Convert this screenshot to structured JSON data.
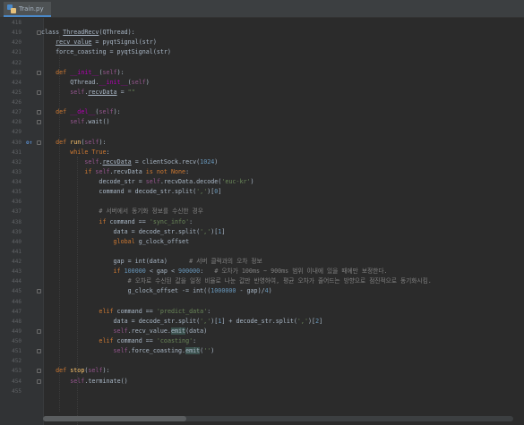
{
  "tab": {
    "label": "Train.py"
  },
  "lines": [
    {
      "num": "418",
      "code": ""
    },
    {
      "num": "419",
      "code": "class <span class=\"ul\">ThreadRecv</span>(QThread):"
    },
    {
      "num": "420",
      "code": "    <span class=\"ul\">recv_value</span> = pyqtSignal(str)"
    },
    {
      "num": "421",
      "code": "    force_coasting = pyqtSignal(str)"
    },
    {
      "num": "422",
      "code": ""
    },
    {
      "num": "423",
      "code": "    <span class=\"kw\">def</span> <span class=\"dn\">__init__</span>(<span class=\"sf\">self</span>):"
    },
    {
      "num": "424",
      "code": "        QThread.<span class=\"dn\">__init__</span>(<span class=\"sf\">self</span>)"
    },
    {
      "num": "425",
      "code": "        <span class=\"sf\">self</span>.<span class=\"ul\">recvData</span> = <span class=\"st\">\"\"</span>"
    },
    {
      "num": "426",
      "code": ""
    },
    {
      "num": "427",
      "code": "    <span class=\"kw\">def</span> <span class=\"dn\">__del__</span>(<span class=\"sf\">self</span>):"
    },
    {
      "num": "428",
      "code": "        <span class=\"sf\">self</span>.wait()"
    },
    {
      "num": "429",
      "code": ""
    },
    {
      "num": "430",
      "code": "    <span class=\"kw\">def</span> <span class=\"fn\">run</span>(<span class=\"sf\">self</span>):",
      "marker": "o↑"
    },
    {
      "num": "431",
      "code": "        <span class=\"kw\">while</span> <span class=\"kw\">True</span>:"
    },
    {
      "num": "432",
      "code": "            <span class=\"sf\">self</span>.<span class=\"ul\">recvData</span> = clientSock.recv(<span class=\"nm\">1024</span>)"
    },
    {
      "num": "433",
      "code": "            <span class=\"kw\">if</span> <span class=\"sf\">self</span>.recvData <span class=\"kw\">is not None</span>:"
    },
    {
      "num": "434",
      "code": "                decode_str = <span class=\"sf\">self</span>.recvData.decode(<span class=\"st\">'euc-kr'</span>)"
    },
    {
      "num": "435",
      "code": "                command = decode_str.split(<span class=\"st\">','</span>)[<span class=\"nm\">0</span>]"
    },
    {
      "num": "436",
      "code": ""
    },
    {
      "num": "437",
      "code": "                <span class=\"cm\"># 서버에서 동기화 정보를 수신한 경우</span>"
    },
    {
      "num": "438",
      "code": "                <span class=\"kw\">if</span> command == <span class=\"st\">'sync_info'</span>:"
    },
    {
      "num": "439",
      "code": "                    data = decode_str.split(<span class=\"st\">','</span>)[<span class=\"nm\">1</span>]"
    },
    {
      "num": "440",
      "code": "                    <span class=\"kw\">global</span> g_clock_offset"
    },
    {
      "num": "441",
      "code": ""
    },
    {
      "num": "442",
      "code": "                    gap = int(data)      <span class=\"cm\"># 서버 클럭과의 오차 정보</span>"
    },
    {
      "num": "443",
      "code": "                    <span class=\"kw\">if</span> <span class=\"nm\">100000</span> &lt; gap &lt; <span class=\"nm\">900000</span>:   <span class=\"cm\"># 오차가 100ms ~ 900ms 범위 이내에 있을 때에만 보정한다.</span>"
    },
    {
      "num": "444",
      "code": "                        <span class=\"cm\"># 오차로 수신된 값을 일정 비율로 나눈 값만 반영하여, 평균 오차가 줄어드는 방향으로 점진적으로 동기화시킴.</span>"
    },
    {
      "num": "445",
      "code": "                        g_clock_offset -= int((<span class=\"nm\">1000000</span> - gap)/<span class=\"nm\">4</span>)"
    },
    {
      "num": "446",
      "code": ""
    },
    {
      "num": "447",
      "code": "                <span class=\"kw\">elif</span> command == <span class=\"st\">'predict_data'</span>:"
    },
    {
      "num": "448",
      "code": "                    data = decode_str.split(<span class=\"st\">','</span>)[<span class=\"nm\">1</span>] + decode_str.split(<span class=\"st\">','</span>)[<span class=\"nm\">2</span>]"
    },
    {
      "num": "449",
      "code": "                    <span class=\"sf\">self</span>.recv_value.<span class=\"hl\">emit</span>(data)"
    },
    {
      "num": "450",
      "code": "                <span class=\"kw\">elif</span> command == <span class=\"st\">'coasting'</span>:"
    },
    {
      "num": "451",
      "code": "                    <span class=\"sf\">self</span>.force_coasting.<span class=\"hl\">emit</span>(<span class=\"st\">''</span>)"
    },
    {
      "num": "452",
      "code": ""
    },
    {
      "num": "453",
      "code": "    <span class=\"kw\">def</span> <span class=\"fn\">stop</span>(<span class=\"sf\">self</span>):"
    },
    {
      "num": "454",
      "code": "        <span class=\"sf\">self</span>.terminate()"
    },
    {
      "num": "455",
      "code": ""
    }
  ]
}
